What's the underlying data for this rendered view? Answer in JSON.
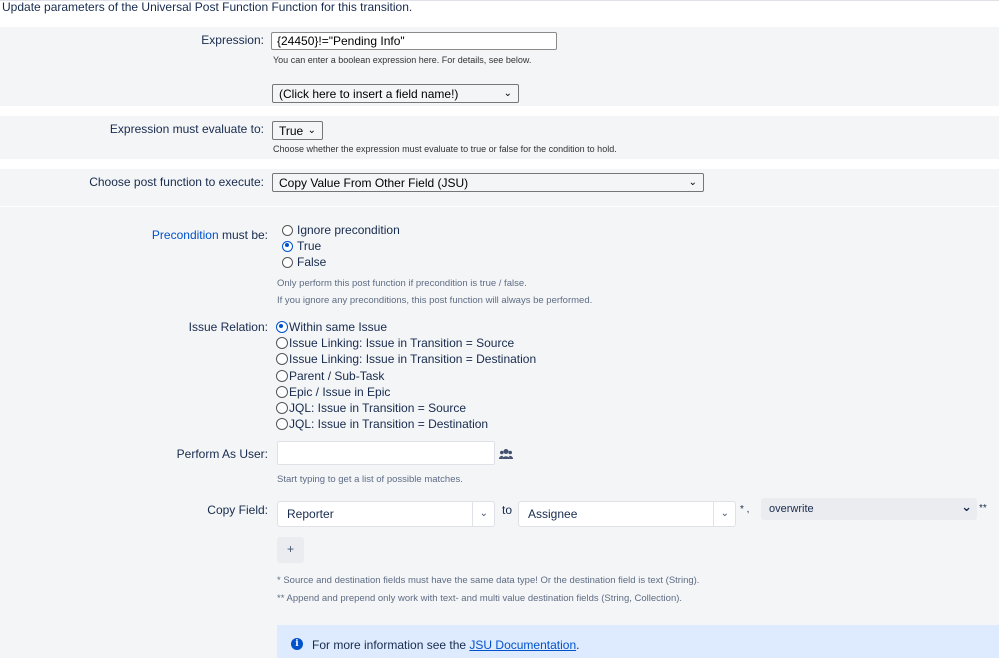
{
  "header": {
    "title": "Update parameters of the Universal Post Function Function for this transition."
  },
  "expression": {
    "label": "Expression:",
    "value": "{24450}!=\"Pending Info\"",
    "hint": "You can enter a boolean expression here. For details, see below.",
    "field_selector": "(Click here to insert a field name!)"
  },
  "evaluate": {
    "label": "Expression must evaluate to:",
    "value": "True",
    "hint": "Choose whether the expression must evaluate to true or false for the condition to hold."
  },
  "post_function": {
    "label": "Choose post function to execute:",
    "value": "Copy Value From Other Field (JSU)"
  },
  "precondition": {
    "link_label": "Precondition",
    "label_suffix": " must be:",
    "options": [
      "Ignore precondition",
      "True",
      "False"
    ],
    "selected_index": 1,
    "hint1": "Only perform this post function if precondition is true / false.",
    "hint2": "If you ignore any preconditions, this post function will always be performed."
  },
  "issue_relation": {
    "label": "Issue Relation:",
    "options": [
      "Within same Issue",
      "Issue Linking: Issue in Transition = Source",
      "Issue Linking: Issue in Transition = Destination",
      "Parent / Sub-Task",
      "Epic / Issue in Epic",
      "JQL: Issue in Transition = Source",
      "JQL: Issue in Transition = Destination"
    ],
    "selected_index": 0
  },
  "perform_as_user": {
    "label": "Perform As User:",
    "value": "",
    "hint": "Start typing to get a list of possible matches.",
    "icon": "users-icon"
  },
  "copy_field": {
    "label": "Copy Field:",
    "source": "Reporter",
    "to_label": "to",
    "destination": "Assignee",
    "marker": "* ,",
    "mode": "overwrite",
    "mode_marker": "**",
    "add_label": "+",
    "note1": "* Source and destination fields must have the same data type! Or the destination field is text (String).",
    "note2": "** Append and prepend only work with text- and multi value destination fields (String, Collection)."
  },
  "info": {
    "prefix": "For more information see the ",
    "link": "JSU Documentation",
    "suffix": "."
  }
}
